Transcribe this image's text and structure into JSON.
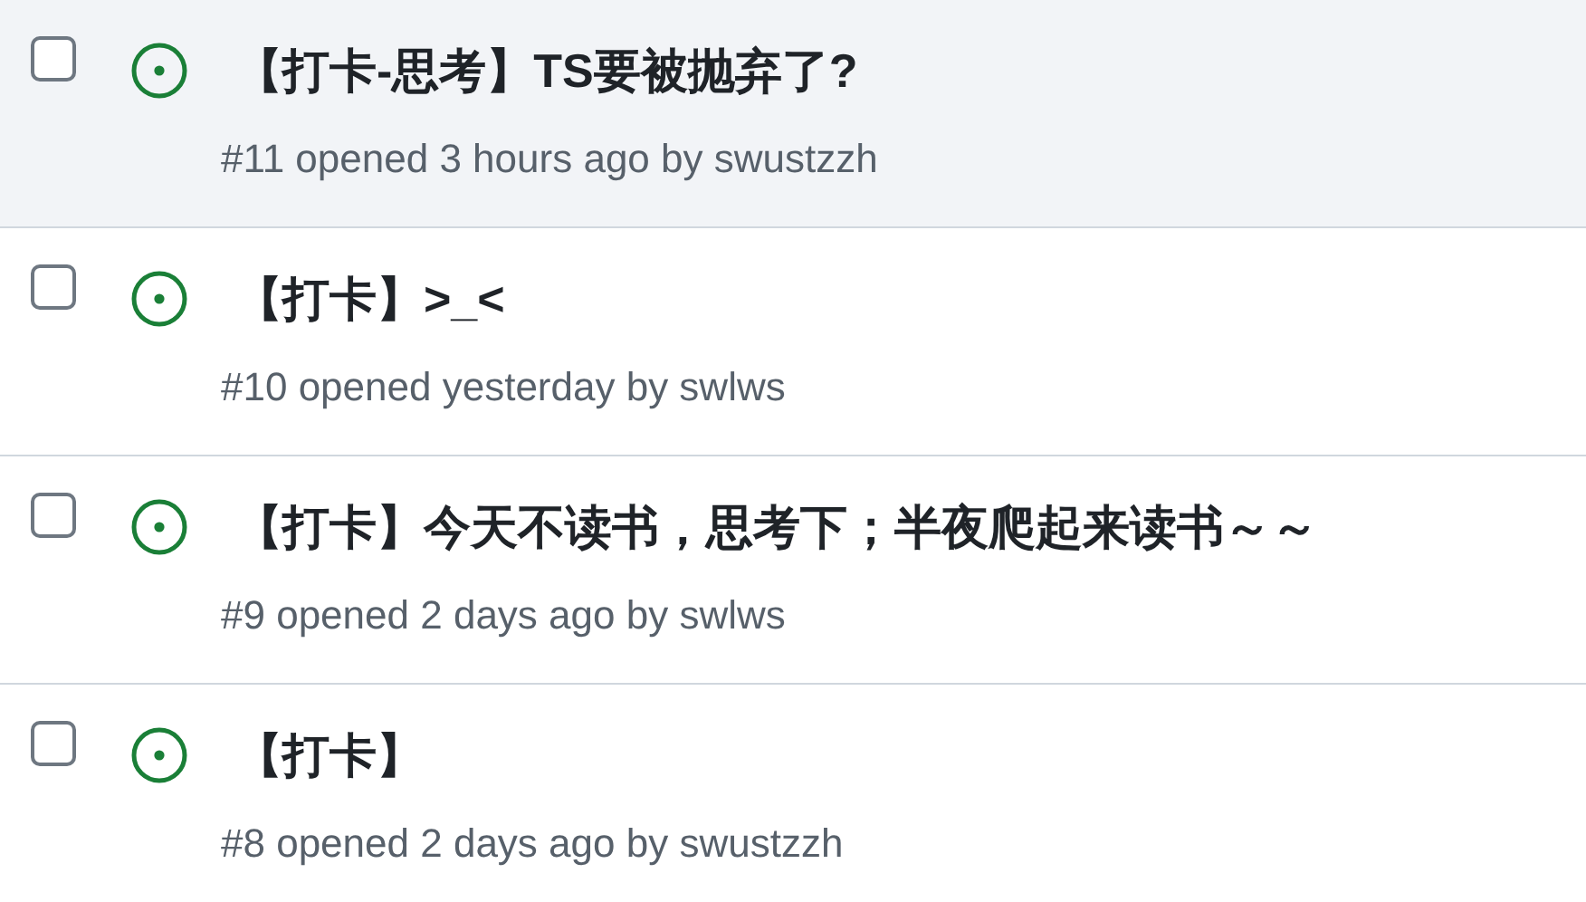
{
  "issues": [
    {
      "title": "【打卡-思考】TS要被抛弃了?",
      "meta": "#11 opened 3 hours ago by swustzzh",
      "checked": false,
      "highlighted": true
    },
    {
      "title": "【打卡】>_<",
      "meta": "#10 opened yesterday by swlws",
      "checked": false,
      "highlighted": false
    },
    {
      "title": "【打卡】今天不读书，思考下；半夜爬起来读书～～",
      "meta": "#9 opened 2 days ago by swlws",
      "checked": false,
      "highlighted": false
    },
    {
      "title": "【打卡】",
      "meta": "#8 opened 2 days ago by swustzzh",
      "checked": false,
      "highlighted": false
    }
  ]
}
